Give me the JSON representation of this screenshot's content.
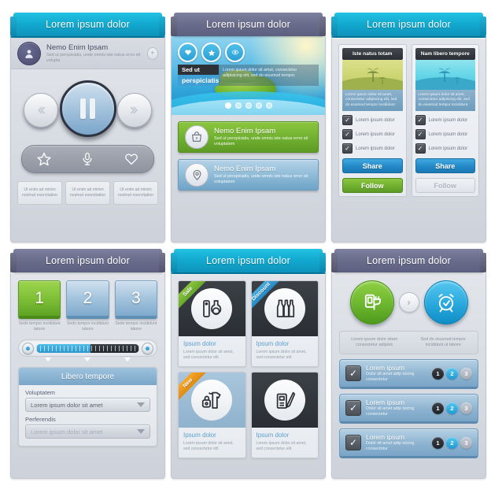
{
  "panels": [
    {
      "id": "media-player",
      "header": "Lorem ipsum dolor",
      "user": {
        "name": "Nemo Enim Ipsam",
        "desc": "Sed ut perspiciatis, unde omnis iste natus error sit volupta",
        "add_label": "+"
      },
      "controls": {
        "prev": "«",
        "pause": "pause",
        "next": "»"
      },
      "toolbar": [
        "star-icon",
        "microphone-icon",
        "heart-icon"
      ],
      "cards": [
        "Ut enim ad minim nostrud exercitation",
        "Ut enim ad minim nostrud exercitation",
        "Ut enim ad minim nostrud exercitation"
      ]
    },
    {
      "id": "hero-slider",
      "header": "Lorem ipsum dolor",
      "hero": {
        "icons": [
          "heart-icon",
          "star-icon",
          "eye-icon"
        ],
        "caption_line1": "Sed ut",
        "caption_line2": "perspiciatis",
        "caption_body": "Lorem ipsum dolor sit amet, consectetur adipisicing elit, sed do eiusmod tempor.",
        "dots": 5,
        "active_dot": 1
      },
      "promos": [
        {
          "icon": "shopping-bag-icon",
          "title": "Nemo Enim Ipsam",
          "desc": "Sed ut perspiciatis, unde omnis iste natus error sit voluptatem",
          "color": "#6fb030"
        },
        {
          "icon": "map-pin-icon",
          "title": "Nemo Enim Ipsam",
          "desc": "Sed ut perspiciatis, unde omnis iste natus error sit voluptatem",
          "color": "#8cb9d6"
        }
      ]
    },
    {
      "id": "compare-columns",
      "header": "Lorem ipsum dolor",
      "columns": [
        {
          "tab": "Iste natus totam",
          "thumb": "olive",
          "desc": "Lorem ipsum dolor sit amet, consectetur adipiscing elit, sed do eiusmod tempor incididunt.",
          "checks": [
            "Lorem ipsum dolor",
            "Lorem ipsum dolor",
            "Lorem ipsum dolor"
          ],
          "share": "Share",
          "follow": "Follow",
          "follow_state": "active"
        },
        {
          "tab": "Nam libero tempore",
          "thumb": "aqua",
          "desc": "Lorem ipsum dolor sit amet, consectetur adipiscing elit, sed do eiusmod tempor incididunt.",
          "checks": [
            "Lorem ipsum dolor",
            "Lorem ipsum dolor",
            "Lorem ipsum dolor"
          ],
          "share": "Share",
          "follow": "Follow",
          "follow_state": "disabled"
        }
      ]
    },
    {
      "id": "steps-form",
      "header": "Lorem ipsum dolor",
      "steps": [
        {
          "num": "1",
          "label": "Sedo tempor incididunt labore",
          "state": "active"
        },
        {
          "num": "2",
          "label": "Sedo tempor incididunt labore",
          "state": "idle"
        },
        {
          "num": "3",
          "label": "Sedo tempor incididunt labore",
          "state": "idle"
        }
      ],
      "slider": {
        "fill_percent": 53
      },
      "form": {
        "title": "Libero tempore",
        "fields": [
          {
            "label": "Voluptatem",
            "value": "Lorem ipsum dolor sit amet",
            "state": "active"
          },
          {
            "label": "Perferendis",
            "value": "Lorem ipsum dolor sit amet",
            "state": "disabled"
          }
        ]
      }
    },
    {
      "id": "product-tiles",
      "header": "Lorem ipsum dolor",
      "tiles": [
        {
          "ribbon": "Sale",
          "ribbon_color": "#8cc63f",
          "icon": "cosmetics-icon",
          "bg": "dark",
          "title": "Ipsum dolor",
          "desc": "Lorem ipsum dolor sit amet, sed consectetur elit"
        },
        {
          "ribbon": "Discount",
          "ribbon_color": "#4aaee2",
          "icon": "bottles-icon",
          "bg": "dark",
          "title": "Ipsum dolor",
          "desc": "Lorem ipsum dolor sit amet, sed consectetur elit"
        },
        {
          "ribbon": "New",
          "ribbon_color": "#f7a82a",
          "icon": "clothes-icon",
          "bg": "lightblue",
          "title": "Ipsum dolor",
          "desc": "Lorem ipsum dolor sit amet, sed consectetur elit"
        },
        {
          "ribbon": "",
          "ribbon_color": "",
          "icon": "notebook-pen-icon",
          "bg": "dark",
          "title": "Ipsum dolor",
          "desc": "Lorem ipsum dolor sit amet, sed consectetur elit"
        }
      ]
    },
    {
      "id": "checklist",
      "header": "Lorem ipsum dolor",
      "big_icons": [
        {
          "name": "plug-device-icon",
          "color": "#6cb62f"
        },
        {
          "name": "alarm-clock-icon",
          "color": "#2aa8dd"
        }
      ],
      "arrow": "›",
      "info": [
        "Lorem ipsum dolor sitam consectetur adipisic",
        "Sed do eiusmod tempor incididunt ut labore"
      ],
      "rows": [
        {
          "title": "Lorem ipsum",
          "desc": "Dolor sit amet adip isicing consectetur",
          "numbers": [
            "1",
            "2",
            "3"
          ],
          "selected": "2"
        },
        {
          "title": "Lorem ipsum",
          "desc": "Dolor sit amet adip isicing consectetur",
          "numbers": [
            "1",
            "2",
            "3"
          ],
          "selected": "2"
        },
        {
          "title": "Lorem ipsum",
          "desc": "Dolor sit amet adip isicing consectetur",
          "numbers": [
            "1",
            "2",
            "3"
          ],
          "selected": "2"
        }
      ]
    }
  ]
}
